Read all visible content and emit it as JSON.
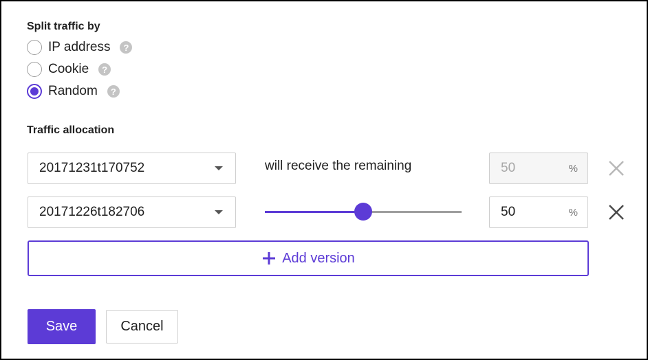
{
  "split": {
    "title": "Split traffic by",
    "options": [
      {
        "label": "IP address",
        "selected": false,
        "help_icon": "question-icon"
      },
      {
        "label": "Cookie",
        "selected": false,
        "help_icon": "question-icon"
      },
      {
        "label": "Random",
        "selected": true,
        "help_icon": "question-icon"
      }
    ]
  },
  "allocation": {
    "title": "Traffic allocation",
    "rows": [
      {
        "version": "20171231t170752",
        "remaining_text": "will receive the remaining",
        "percent": "50",
        "unit": "%",
        "editable": false,
        "remove_icon": "close-icon"
      },
      {
        "version": "20171226t182706",
        "slider_value_percent": 50,
        "percent": "50",
        "unit": "%",
        "editable": true,
        "remove_icon": "close-icon"
      }
    ],
    "add_version_label": "Add version",
    "add_icon": "plus-icon"
  },
  "actions": {
    "save_label": "Save",
    "cancel_label": "Cancel"
  },
  "colors": {
    "accent": "#5c3bd6",
    "border": "#cfcfcf",
    "muted_text": "#a8a8a8"
  }
}
